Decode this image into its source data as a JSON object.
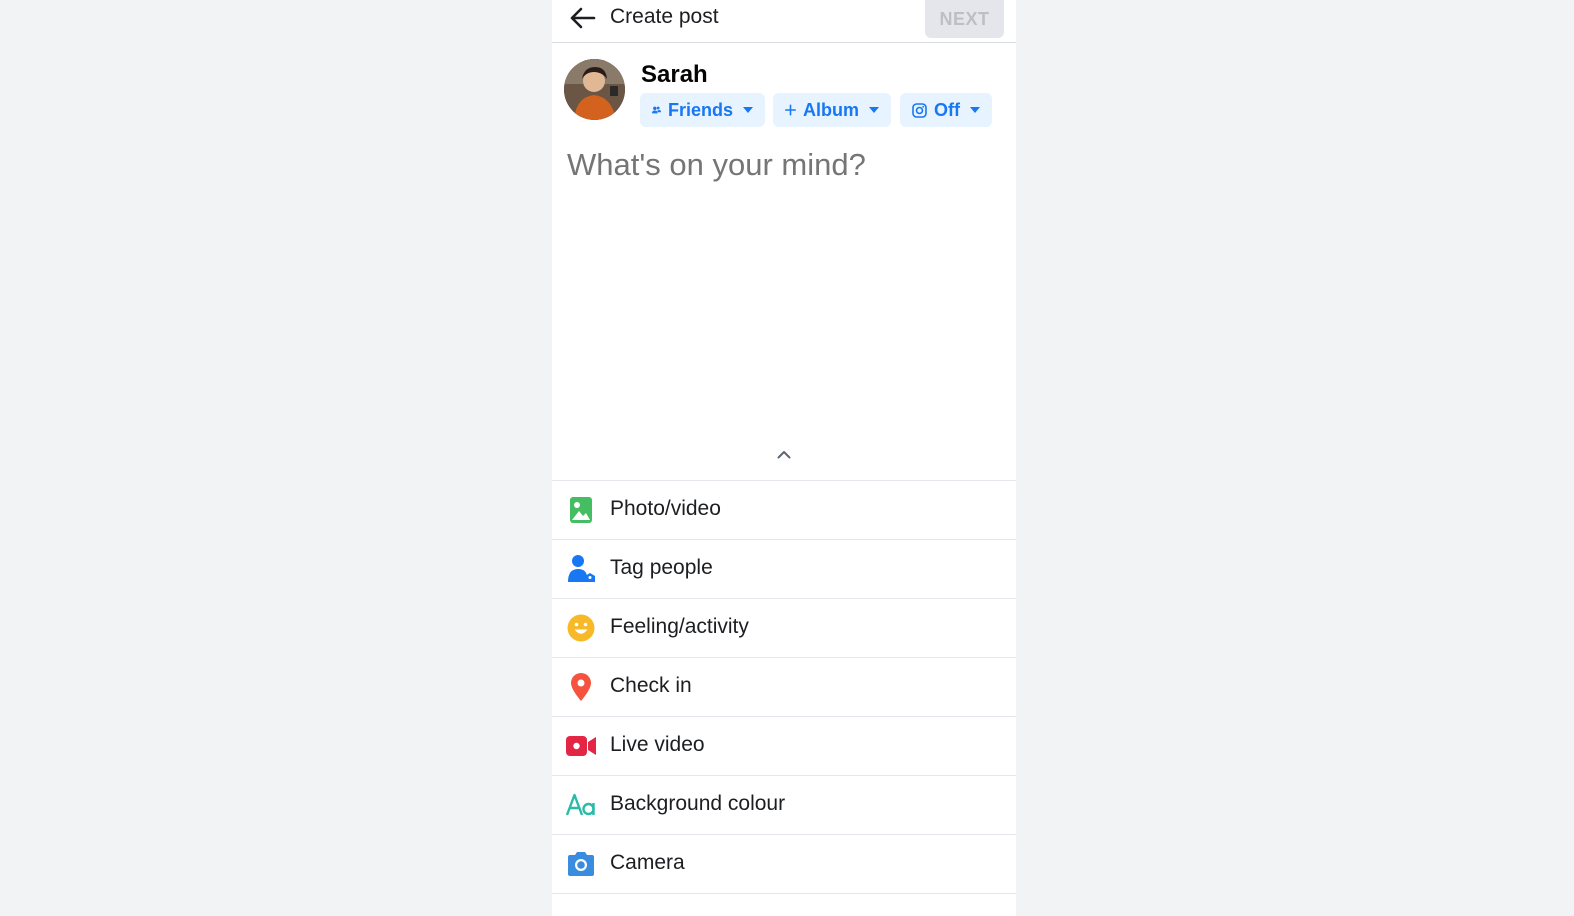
{
  "header": {
    "title": "Create post",
    "next_label": "NEXT"
  },
  "user": {
    "name": "Sarah"
  },
  "audience_chips": [
    {
      "label": "Friends",
      "icon": "friends-icon"
    },
    {
      "label": "Album",
      "icon": "plus-icon"
    },
    {
      "label": "Off",
      "icon": "instagram-icon"
    }
  ],
  "composer": {
    "placeholder": "What's on your mind?"
  },
  "options": [
    {
      "label": "Photo/video",
      "icon": "photo-icon",
      "color": "#45bd62"
    },
    {
      "label": "Tag people",
      "icon": "tag-people-icon",
      "color": "#1877f2"
    },
    {
      "label": "Feeling/activity",
      "icon": "feeling-icon",
      "color": "#f7b928"
    },
    {
      "label": "Check in",
      "icon": "location-pin-icon",
      "color": "#f5533d"
    },
    {
      "label": "Live video",
      "icon": "live-video-icon",
      "color": "#e42645"
    },
    {
      "label": "Background colour",
      "icon": "text-aa-icon",
      "color": "#2abba7"
    },
    {
      "label": "Camera",
      "icon": "camera-icon",
      "color": "#3a8dde"
    }
  ],
  "colors": {
    "accent": "#1877f2",
    "chip_bg": "#e7f3ff",
    "page_bg": "#f2f3f5"
  }
}
